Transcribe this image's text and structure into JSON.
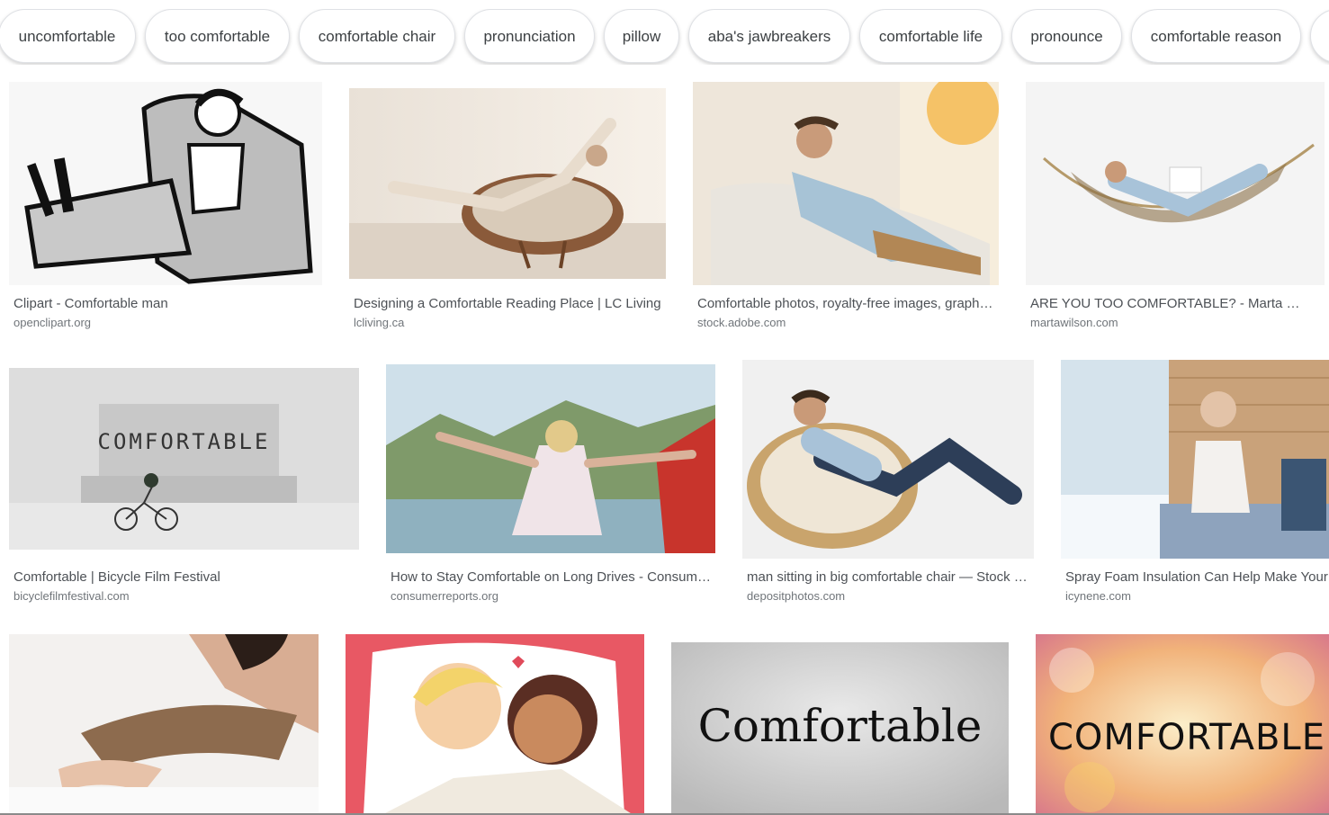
{
  "related_searches": [
    {
      "label": "uncomfortable"
    },
    {
      "label": "too comfortable"
    },
    {
      "label": "comfortable chair"
    },
    {
      "label": "pronunciation"
    },
    {
      "label": "pillow"
    },
    {
      "label": "aba's jawbreakers"
    },
    {
      "label": "comfortable life"
    },
    {
      "label": "pronounce"
    },
    {
      "label": "comfortable reason"
    }
  ],
  "results": [
    {
      "title": "Clipart - Comfortable man",
      "source": "openclipart.org",
      "image": "man-in-armchair-clipart"
    },
    {
      "title": "Designing a Comfortable Reading Place | LC Living",
      "source": "lcliving.ca",
      "image": "woman-stretching-in-papasan-chair"
    },
    {
      "title": "Comfortable photos, royalty-free images, graphics",
      "source": "stock.adobe.com",
      "image": "man-relaxing-on-lounger"
    },
    {
      "title": "ARE YOU TOO COMFORTABLE? - Marta Wilson",
      "source": "martawilson.com",
      "image": "man-in-hammock"
    },
    {
      "title": "Comfortable | Bicycle Film Festival",
      "source": "bicyclefilmfestival.com",
      "image": "snowy-cyclist",
      "overlay_text": "COMFORTABLE"
    },
    {
      "title": "How to Stay Comfortable on Long Drives - Consumer Reports",
      "source": "consumerreports.org",
      "image": "woman-arms-out-mountains"
    },
    {
      "title": "man sitting in big comfortable chair — Stock Photo",
      "source": "depositphotos.com",
      "image": "man-in-round-chair"
    },
    {
      "title": "Spray Foam Insulation Can Help Make Your Home Comfortable",
      "source": "icynene.com",
      "image": "woman-with-mug-by-window"
    },
    {
      "title": "",
      "source": "",
      "image": "person-lying-in-bed"
    },
    {
      "title": "",
      "source": "",
      "image": "cartoon-couple-on-pillow"
    },
    {
      "title": "",
      "source": "",
      "image": "comfortable-word-gray",
      "overlay_text": "Comfortable"
    },
    {
      "title": "",
      "source": "",
      "image": "comfortable-word-bokeh",
      "overlay_text": "COMFORTABLE"
    }
  ],
  "colors": {
    "chip_border": "#dfe1e5",
    "title_text": "#4d5156",
    "source_text": "#70757a"
  }
}
